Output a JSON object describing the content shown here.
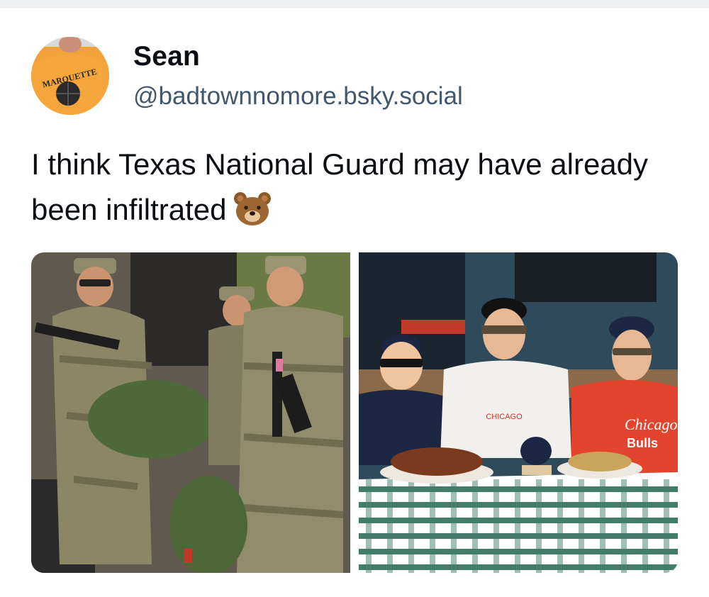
{
  "post": {
    "author": {
      "display_name": "Sean",
      "handle": "@badtownnomore.bsky.social",
      "avatar_text": "MARQUETTE"
    },
    "text": "I think Texas National Guard may have already been infiltrated",
    "emoji": "bear-face",
    "images": [
      {
        "description_icon": "soldiers-photo"
      },
      {
        "description_icon": "bears-fans-photo",
        "visible_texts": [
          "CHICAGO",
          "Chicago",
          "Bulls"
        ]
      }
    ]
  },
  "colors": {
    "name": "#0b0f14",
    "handle": "#42576c",
    "avatar_shirt": "#f2a23a"
  }
}
